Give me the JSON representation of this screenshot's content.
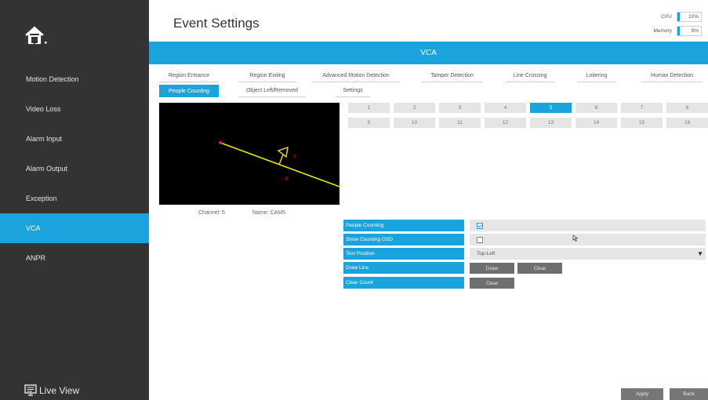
{
  "header": {
    "title": "Event Settings"
  },
  "system": {
    "cpu_label": "CPU",
    "cpu_value": "10%",
    "cpu_pct": 10,
    "memory_label": "Memory",
    "memory_value": "9%",
    "memory_pct": 9
  },
  "sidebar": {
    "items": [
      {
        "label": "Motion Detection"
      },
      {
        "label": "Video Loss"
      },
      {
        "label": "Alarm Input"
      },
      {
        "label": "Alarm Output"
      },
      {
        "label": "Exception"
      },
      {
        "label": "VCA"
      },
      {
        "label": "ANPR"
      }
    ],
    "active": "VCA",
    "live_view": "Live View"
  },
  "banner": "VCA",
  "tabs": [
    {
      "label": "Region Entrance"
    },
    {
      "label": "Region Exiting"
    },
    {
      "label": "Advanced Motion Detection"
    },
    {
      "label": "Tamper Detection"
    },
    {
      "label": "Line Crossing"
    },
    {
      "label": "Loitering"
    },
    {
      "label": "Human Detection"
    },
    {
      "label": "People Counting"
    },
    {
      "label": "Object Left/Removed"
    },
    {
      "label": "Settings"
    }
  ],
  "active_tab": "People Counting",
  "preview": {
    "channel": "Channel: 5",
    "name": "Name: CAM5"
  },
  "channels": [
    "1",
    "2",
    "3",
    "4",
    "5",
    "6",
    "7",
    "8",
    "9",
    "10",
    "11",
    "12",
    "13",
    "14",
    "15",
    "16"
  ],
  "active_channel": "5",
  "settings": {
    "people_counting_label": "People Counting",
    "people_counting_checked": true,
    "show_osd_label": "Show Counting OSD",
    "show_osd_checked": false,
    "text_position_label": "Text Position",
    "text_position_value": "Top-Left",
    "draw_line_label": "Draw Line",
    "draw_button": "Draw",
    "clear_button": "Clear",
    "clear_count_label": "Clear Count",
    "clear_count_button": "Clear"
  },
  "footer": {
    "apply": "Apply",
    "back": "Back"
  },
  "colors": {
    "accent": "#1aa3dc",
    "sidebar": "#333333",
    "line": "#e6e600",
    "marker": "#e02020"
  }
}
